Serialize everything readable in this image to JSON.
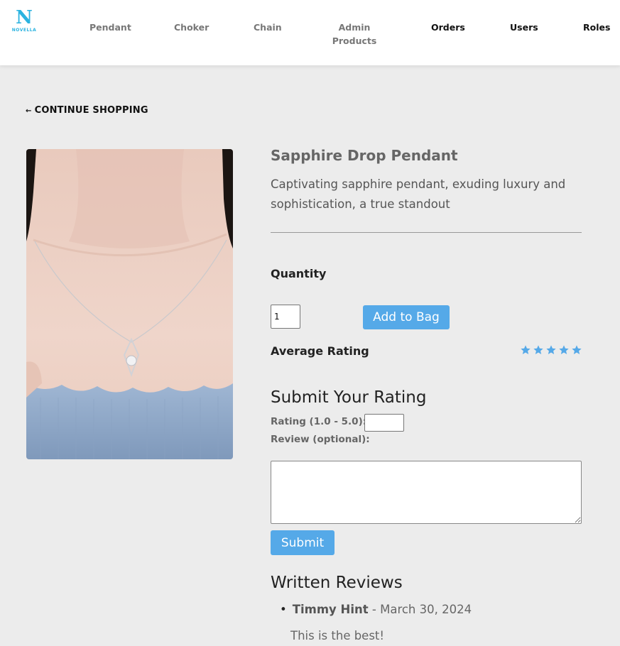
{
  "brand": {
    "logo_mark": "N",
    "logo_word": "NOVELLA",
    "accent": "#2bb3e0"
  },
  "nav": {
    "pendant": "Pendant",
    "choker": "Choker",
    "chain": "Chain",
    "admin_products": "Admin Products",
    "orders": "Orders",
    "users": "Users",
    "roles": "Roles"
  },
  "continue_shopping": {
    "arrow": "←",
    "label": "CONTINUE SHOPPING"
  },
  "product": {
    "image_icon": "necklace-photo",
    "title": "Sapphire Drop Pendant",
    "description": "Captivating sapphire pendant, exuding luxury and sophistication, a true standout"
  },
  "quantity": {
    "label": "Quantity",
    "value": "1"
  },
  "add_to_bag": {
    "label": "Add to Bag",
    "color": "#55a9e8"
  },
  "average_rating": {
    "label": "Average Rating",
    "stars": 5,
    "star_color": "#55a9e8"
  },
  "rating_form": {
    "heading": "Submit Your Rating",
    "rating_label": "Rating (1.0 - 5.0):",
    "rating_value": "",
    "review_label": "Review (optional):",
    "review_value": "",
    "submit_label": "Submit"
  },
  "reviews": {
    "heading": "Written Reviews",
    "items": [
      {
        "author": "Timmy Hint",
        "separator": " - ",
        "date": "March 30, 2024",
        "text": "This is the best!"
      }
    ]
  }
}
